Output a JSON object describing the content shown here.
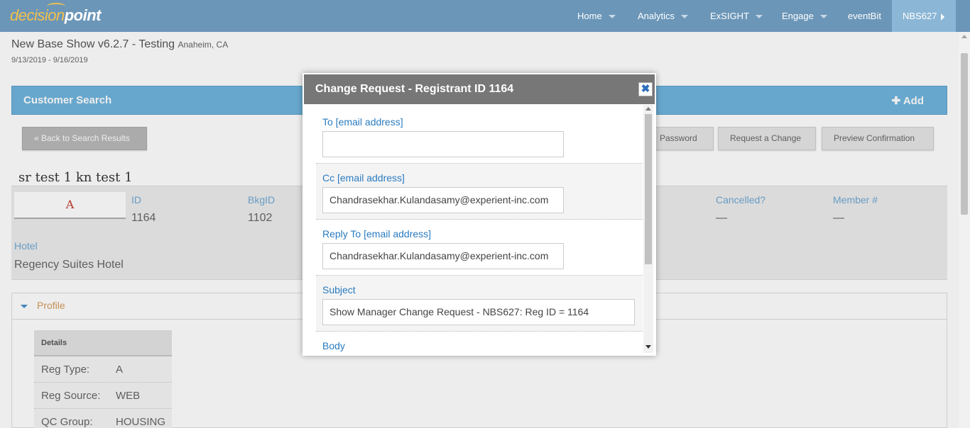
{
  "nav": {
    "logo_part1": "decision",
    "logo_part2": "point",
    "items": [
      {
        "label": "Home"
      },
      {
        "label": "Analytics"
      },
      {
        "label": "ExSIGHT"
      },
      {
        "label": "Engage"
      },
      {
        "label": "eventBit"
      }
    ],
    "show_code": "NBS627"
  },
  "show": {
    "title": "New Base Show v6.2.7 - Testing",
    "location": "Anaheim, CA",
    "dates": "9/13/2019 - 9/16/2019"
  },
  "customer_search": {
    "label": "Customer Search",
    "add_label": "Add"
  },
  "buttons": {
    "back": "« Back to Search Results",
    "password": "Password",
    "request_change": "Request a Change",
    "preview_confirmation": "Preview Confirmation"
  },
  "registrant": {
    "name": "sr test 1 kn test 1",
    "reg_type_badge": "A",
    "fields": {
      "id_label": "ID",
      "id_value": "1164",
      "bkgid_label": "BkgID",
      "bkgid_value": "1102",
      "cancelled_label": "Cancelled?",
      "cancelled_value": "—",
      "member_label": "Member #",
      "member_value": "—",
      "hotel_label": "Hotel",
      "hotel_value": "Regency Suites Hotel"
    }
  },
  "profile": {
    "label": "Profile",
    "details_header": "Details",
    "rows": [
      {
        "key": "Reg Type:",
        "value": "A"
      },
      {
        "key": "Reg Source:",
        "value": "WEB"
      },
      {
        "key": "QC Group:",
        "value": "HOUSING"
      }
    ]
  },
  "modal": {
    "title": "Change Request - Registrant ID 1164",
    "close_glyph": "✖",
    "to_label": "To [email address]",
    "to_value": "",
    "cc_label": "Cc [email address]",
    "cc_value": "Chandrasekhar.Kulandasamy@experient-inc.com",
    "replyto_label": "Reply To [email address]",
    "replyto_value": "Chandrasekhar.Kulandasamy@experient-inc.com",
    "subject_label": "Subject",
    "subject_value": "Show Manager Change Request - NBS627:  Reg ID = 1164",
    "body_label": "Body"
  },
  "colors": {
    "nav_bg": "#6b96b8",
    "accent_blue": "#6fb4dd",
    "modal_header": "#777777",
    "label_blue": "#2a7bbf"
  }
}
